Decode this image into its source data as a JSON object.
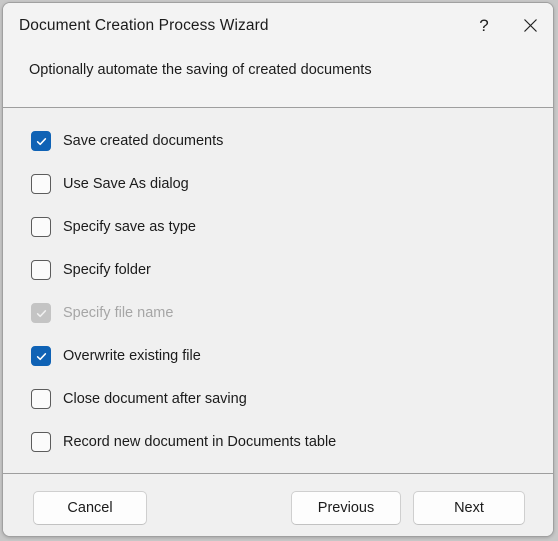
{
  "window": {
    "title": "Document Creation Process Wizard",
    "subtitle": "Optionally automate the saving of created documents",
    "help_icon": "?",
    "close_icon": "close-icon",
    "accent_color": "#0f62b5",
    "background_color": "#f0f0f0",
    "titlebar_color": "#f3f3f3"
  },
  "options": [
    {
      "label": "Save created documents",
      "state": "checked"
    },
    {
      "label": "Use Save As dialog",
      "state": "unchecked"
    },
    {
      "label": "Specify save as type",
      "state": "unchecked"
    },
    {
      "label": "Specify folder",
      "state": "unchecked"
    },
    {
      "label": "Specify file name",
      "state": "disabled-checked"
    },
    {
      "label": "Overwrite existing file",
      "state": "checked"
    },
    {
      "label": "Close document after saving",
      "state": "unchecked"
    },
    {
      "label": "Record new document in Documents table",
      "state": "unchecked"
    }
  ],
  "footer": {
    "cancel_label": "Cancel",
    "previous_label": "Previous",
    "next_label": "Next"
  }
}
